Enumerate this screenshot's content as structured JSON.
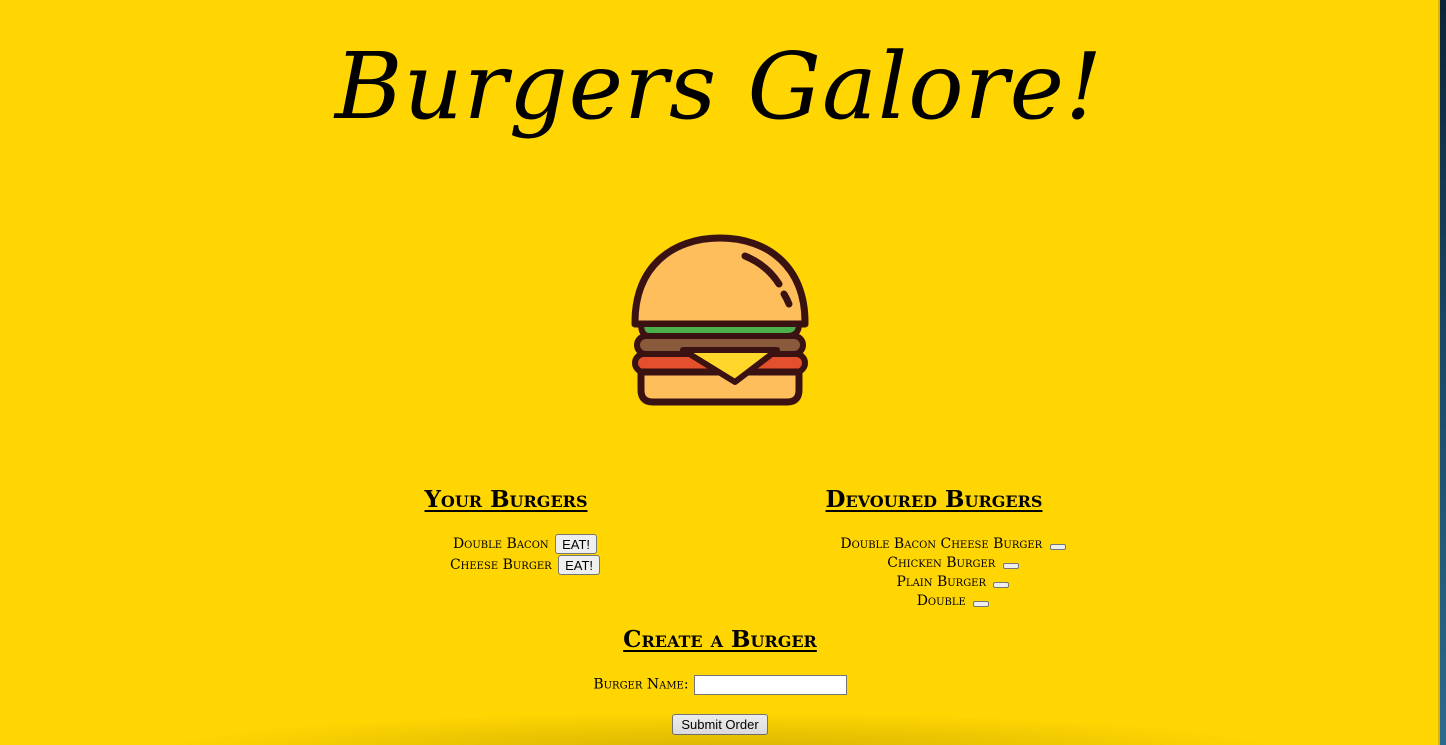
{
  "page": {
    "title": "Burgers Galore!",
    "logo_icon": "hamburger-icon",
    "background_color": "#ffd502"
  },
  "your_burgers": {
    "heading": "Your Burgers",
    "items": [
      {
        "name": "Double Bacon",
        "button_label": "EAT!"
      },
      {
        "name": "Cheese Burger",
        "button_label": "EAT!"
      }
    ]
  },
  "devoured_burgers": {
    "heading": "Devoured Burgers",
    "items": [
      {
        "name": "Double Bacon Cheese Burger"
      },
      {
        "name": "Chicken Burger"
      },
      {
        "name": "Plain Burger"
      },
      {
        "name": "Double"
      }
    ]
  },
  "create_burger": {
    "heading": "Create a Burger",
    "label": "Burger Name:",
    "input_value": "",
    "submit_label": "Submit Order"
  }
}
